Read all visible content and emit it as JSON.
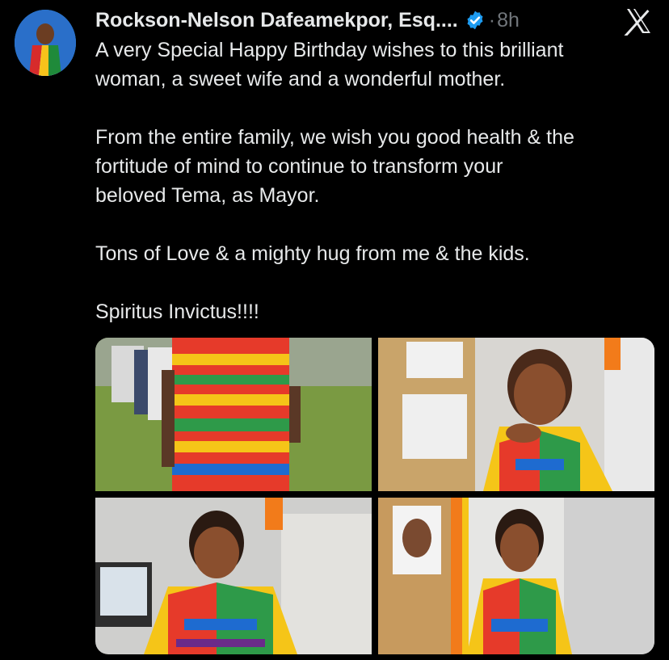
{
  "tweet": {
    "author_name": "Rockson-Nelson Dafeamekpor, Esq....",
    "time_separator": "·",
    "time": "8h",
    "text": "A very Special Happy Birthday wishes to this brilliant\nwoman, a sweet wife and a wonderful mother.\n\nFrom the entire family, we wish you good health & the\nfortitude of mind to continue to transform your\nbeloved Tema, as Mayor.\n\nTons of Love & a mighty hug from me & the kids.\n\nSpiritus Invictus!!!!",
    "media_count": 4
  },
  "icons": {
    "verified": "verified-badge-icon",
    "brand": "x-logo-icon"
  },
  "colors": {
    "background": "#000000",
    "text": "#e7e9ea",
    "muted": "#71767b",
    "verified": "#1d9bf0"
  }
}
